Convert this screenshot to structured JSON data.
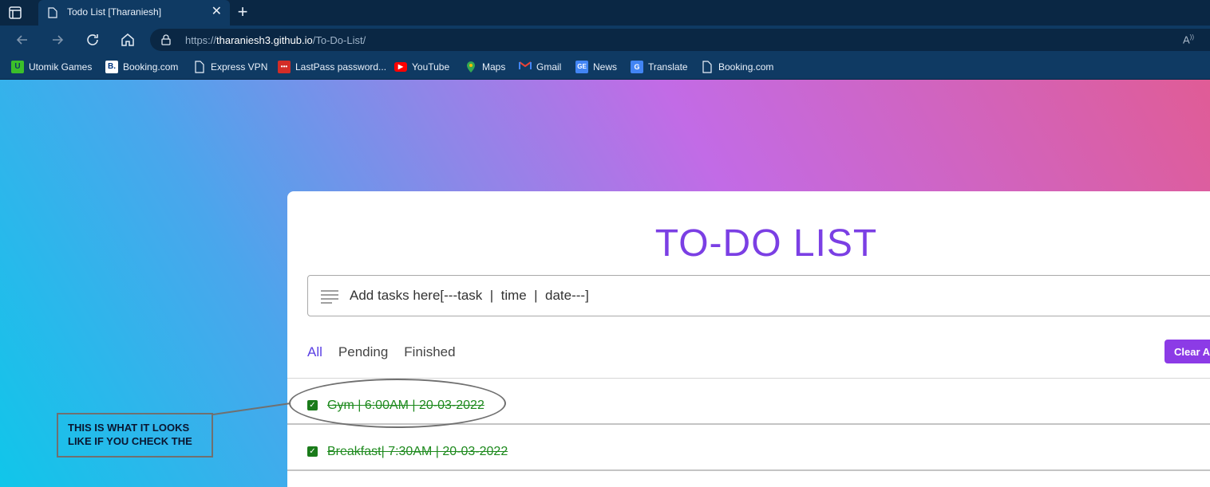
{
  "browser": {
    "tab_title": "Todo List [Tharaniesh]",
    "url_prefix": "https://",
    "url_host": "tharaniesh3.github.io",
    "url_path": "/To-Do-List/"
  },
  "bookmarks": [
    {
      "label": "Utomik Games",
      "icon": "utomik-icon",
      "color": "#3bbf2a"
    },
    {
      "label": "Booking.com",
      "icon": "booking-icon",
      "color": "#ffffff"
    },
    {
      "label": "Express VPN",
      "icon": "page-icon",
      "color": "#ffffff"
    },
    {
      "label": "LastPass password...",
      "icon": "lastpass-icon",
      "color": "#d32d27"
    },
    {
      "label": "YouTube",
      "icon": "youtube-icon",
      "color": "#ff0000"
    },
    {
      "label": "Maps",
      "icon": "maps-icon",
      "color": "#34a853"
    },
    {
      "label": "Gmail",
      "icon": "gmail-icon",
      "color": "#ea4335"
    },
    {
      "label": "News",
      "icon": "news-icon",
      "color": "#4285f4"
    },
    {
      "label": "Translate",
      "icon": "translate-icon",
      "color": "#4285f4"
    },
    {
      "label": "Booking.com",
      "icon": "page-icon",
      "color": "#ffffff"
    }
  ],
  "app": {
    "title": "TO-DO LIST",
    "input_placeholder": "Add tasks here[---task  |  time  |  date---]",
    "filters": [
      "All",
      "Pending",
      "Finished"
    ],
    "active_filter": "All",
    "clear_label": "Clear A",
    "accent_color": "#8c3be6",
    "tasks": [
      {
        "text": "Gym | 6:00AM | 20-03-2022",
        "checked": true
      },
      {
        "text": "Breakfast| 7:30AM | 20-03-2022",
        "checked": true
      }
    ]
  },
  "annotation": {
    "line1": "THIS IS WHAT IT LOOKS",
    "line2": "LIKE IF YOU CHECK THE"
  }
}
